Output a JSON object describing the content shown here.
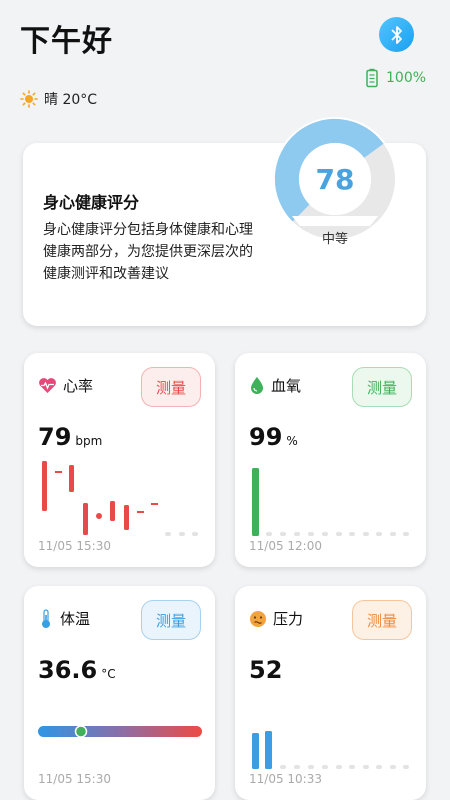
{
  "header": {
    "greeting": "下午好",
    "battery": "100%",
    "bluetooth_icon": "bluetooth-icon"
  },
  "weather": {
    "icon": "sun-icon",
    "text": "晴 20°C"
  },
  "health_score": {
    "title": "身心健康评分",
    "description": "身心健康评分包括身体健康和心理健康两部分，为您提供更深层次的健康测评和改善建议",
    "score": "78",
    "level": "中等"
  },
  "cards": {
    "heart": {
      "label": "心率",
      "button": "测量",
      "value": "79",
      "unit": "bpm",
      "time": "11/05 15:30",
      "accent": "#e84a4a"
    },
    "oxygen": {
      "label": "血氧",
      "button": "测量",
      "value": "99",
      "unit": "%",
      "time": "11/05 12:00",
      "accent": "#3eb15a"
    },
    "temperature": {
      "label": "体温",
      "button": "测量",
      "value": "36.6",
      "unit": "°C",
      "time": "11/05 15:30",
      "accent": "#3a9ee0"
    },
    "stress": {
      "label": "压力",
      "button": "测量",
      "value": "52",
      "unit": "",
      "time": "11/05 10:33",
      "accent": "#f08a3c"
    }
  }
}
